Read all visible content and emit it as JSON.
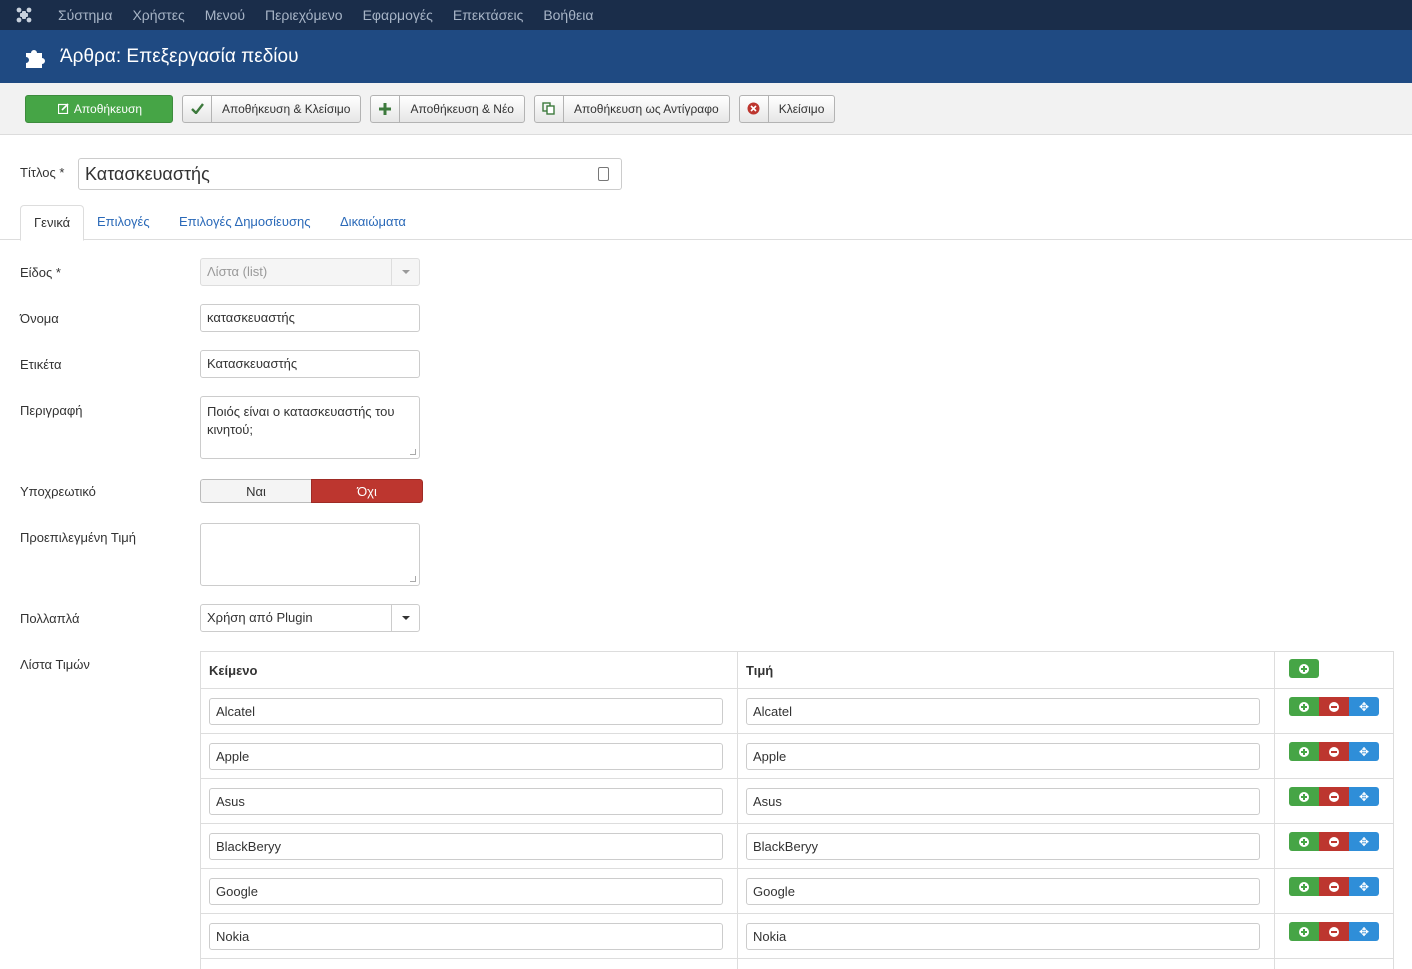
{
  "topnav": {
    "items": [
      "Σύστημα",
      "Χρήστες",
      "Μενού",
      "Περιεχόμενο",
      "Εφαρμογές",
      "Επεκτάσεις",
      "Βοήθεια"
    ]
  },
  "header": {
    "title": "Άρθρα: Επεξεργασία πεδίου"
  },
  "toolbar": {
    "save": "Αποθήκευση",
    "save_close": "Αποθήκευση & Κλείσιμο",
    "save_new": "Αποθήκευση & Νέο",
    "save_copy": "Αποθήκευση ως Αντίγραφο",
    "close": "Κλείσιμο"
  },
  "title_field": {
    "label": "Τίτλος *",
    "value": "Κατασκευαστής"
  },
  "tabs": [
    "Γενικά",
    "Επιλογές",
    "Επιλογές Δημοσίευσης",
    "Δικαιώματα"
  ],
  "form": {
    "type": {
      "label": "Είδος *",
      "value": "Λίστα (list)"
    },
    "name": {
      "label": "Όνομα",
      "value": "κατασκευαστής"
    },
    "tag": {
      "label": "Ετικέτα",
      "value": "Κατασκευαστής"
    },
    "description": {
      "label": "Περιγραφή",
      "value": "Ποιός είναι ο κατασκευαστής του κινητού;"
    },
    "required": {
      "label": "Υποχρεωτικό",
      "yes": "Ναι",
      "no": "Όχι",
      "selected": "Όχι"
    },
    "default_value": {
      "label": "Προεπιλεγμένη Τιμή",
      "value": ""
    },
    "multiple": {
      "label": "Πολλαπλά",
      "value": "Χρήση από Plugin"
    },
    "values_list": {
      "label": "Λίστα Τιμών",
      "col_text": "Κείμενο",
      "col_value": "Τιμή",
      "rows": [
        {
          "text": "Alcatel",
          "value": "Alcatel"
        },
        {
          "text": "Apple",
          "value": "Apple"
        },
        {
          "text": "Asus",
          "value": "Asus"
        },
        {
          "text": "BlackBeryy",
          "value": "BlackBeryy"
        },
        {
          "text": "Google",
          "value": "Google"
        },
        {
          "text": "Nokia",
          "value": "Nokia"
        }
      ]
    }
  },
  "colors": {
    "topnav_bg": "#1a2d4a",
    "header_bg": "#1f4a82",
    "success": "#46a546",
    "danger": "#bd362f",
    "info": "#2f8ed8",
    "link": "#2a69b8"
  }
}
